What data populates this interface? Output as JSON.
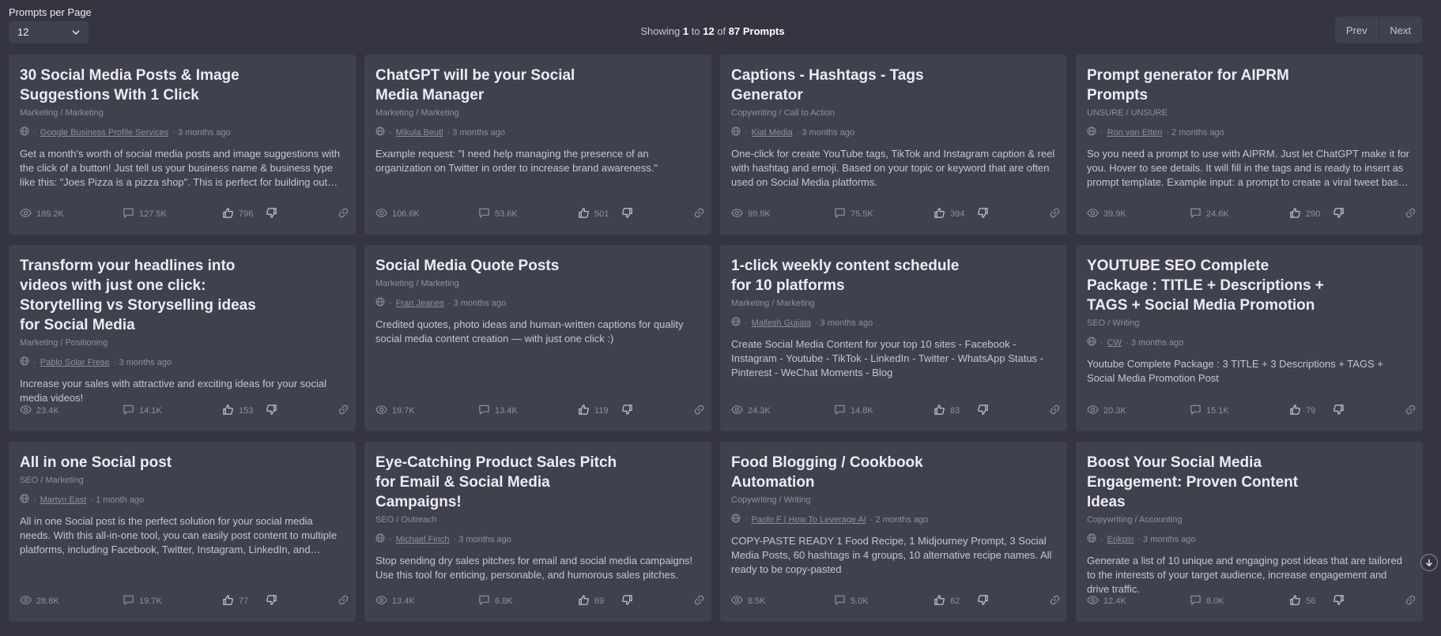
{
  "prompts_per_page": {
    "label": "Prompts per Page",
    "value": "12"
  },
  "pagination": {
    "showing_prefix": "Showing",
    "from": "1",
    "to_word": "to",
    "to": "12",
    "of_word": "of",
    "total": "87 Prompts",
    "prev": "Prev",
    "next": "Next"
  },
  "cards": [
    {
      "title": "30 Social Media Posts & Image Suggestions With 1 Click",
      "category": "Marketing / Marketing",
      "author": "Google Business Profile Services",
      "age": "· 3 months ago",
      "description": "Get a month's worth of social media posts and image suggestions with the click of a button! Just tell us your business name & business type like this: \"Joes Pizza is a pizza shop\". This is perfect for building out your social media calendar.",
      "views": "189.2K",
      "comments": "127.5K",
      "likes": "796"
    },
    {
      "title": "ChatGPT will be your Social Media Manager",
      "category": "Marketing / Marketing",
      "author": "Mikula Beutl",
      "age": "· 3 months ago",
      "description": "Example request: \"I need help managing the presence of an organization on Twitter in order to increase brand awareness.\"",
      "views": "106.6K",
      "comments": "53.6K",
      "likes": "501"
    },
    {
      "title": "Captions - Hashtags - Tags Generator",
      "category": "Copywriting / Call to Action",
      "author": "Kiat Media",
      "age": "· 3 months ago",
      "description": "One-click for create YouTube tags, TikTok and Instagram caption & reel with hashtag and emoji. Based on your topic or keyword that are often used on Social Media platforms.",
      "views": "99.9K",
      "comments": "75.5K",
      "likes": "394"
    },
    {
      "title": "Prompt generator for AIPRM Prompts",
      "category": "UNSURE / UNSURE",
      "author": "Ron van Etten",
      "age": "· 2 months ago",
      "description": "So you need a prompt to use with AIPRM. Just let ChatGPT make it for you. Hover to see details. It will fill in the tags and is ready to insert as prompt template. Example input: a prompt to create a viral tweet based on a topic",
      "views": "39.9K",
      "comments": "24.6K",
      "likes": "290"
    },
    {
      "title": "Transform your headlines into videos with just one click: Storytelling vs Storyselling ideas for Social Media",
      "category": "Marketing / Positioning",
      "author": "Pablo Solar Frese",
      "age": "· 3 months ago",
      "description": "Increase your sales with attractive and exciting ideas for your social media videos!",
      "views": "23.4K",
      "comments": "14.1K",
      "likes": "153"
    },
    {
      "title": "Social Media Quote Posts",
      "category": "Marketing / Marketing",
      "author": "Fran Jeanes",
      "age": "· 3 months ago",
      "description": "Credited quotes, photo ideas and human-written captions for quality social media content creation — with just one click :)",
      "views": "19.7K",
      "comments": "13.4K",
      "likes": "119"
    },
    {
      "title": "1-click weekly content schedule for 10 platforms",
      "category": "Marketing / Marketing",
      "author": "Mallesh Gujjala",
      "age": "· 3 months ago",
      "description": "Create Social Media Content for your top 10 sites - Facebook - Instagram - Youtube - TikTok - LinkedIn - Twitter - WhatsApp Status - Pinterest - WeChat Moments - Blog",
      "views": "24.3K",
      "comments": "14.8K",
      "likes": "83"
    },
    {
      "title": "YOUTUBE SEO Complete Package : TITLE + Descriptions + TAGS + Social Media Promotion",
      "category": "SEO / Writing",
      "author": "CW",
      "age": "· 3 months ago",
      "description": "Youtube Complete Package : 3 TITLE + 3 Descriptions + TAGS + Social Media Promotion Post",
      "views": "20.3K",
      "comments": "15.1K",
      "likes": "79"
    },
    {
      "title": "All in one Social post",
      "category": "SEO / Marketing",
      "author": "Martyn East",
      "age": "· 1 month ago",
      "description": "All in one Social post is the perfect solution for your social media needs. With this all-in-one tool, you can easily post content to multiple platforms, including Facebook, Twitter, Instagram, LinkedIn, and YouTube, and be sure it works.",
      "views": "28.8K",
      "comments": "19.7K",
      "likes": "77"
    },
    {
      "title": "Eye-Catching Product Sales Pitch for Email & Social Media Campaigns!",
      "category": "SEO / Outreach",
      "author": "Michael Finch",
      "age": "· 3 months ago",
      "description": "Stop sending dry sales pitches for email and social media campaigns! Use this tool for enticing, personable, and humorous sales pitches.",
      "views": "13.4K",
      "comments": "6.8K",
      "likes": "69"
    },
    {
      "title": "Food Blogging / Cookbook Automation",
      "category": "Copywriting / Writing",
      "author": "Paolo F | How To Leverage AI",
      "age": "· 2 months ago",
      "description": "COPY-PASTE READY 1 Food Recipe, 1 Midjourney Prompt, 3 Social Media Posts, 60 hashtags in 4 groups, 10 alternative recipe names. All ready to be copy-pasted",
      "views": "8.5K",
      "comments": "5.0K",
      "likes": "62"
    },
    {
      "title": "Boost Your Social Media Engagement: Proven Content Ideas",
      "category": "Copywriting / Accounting",
      "author": "Erikpin",
      "age": "· 3 months ago",
      "description": "Generate a list of 10 unique and engaging post ideas that are tailored to the interests of your target audience, increase engagement and drive traffic.",
      "views": "12.4K",
      "comments": "8.0K",
      "likes": "56"
    }
  ]
}
